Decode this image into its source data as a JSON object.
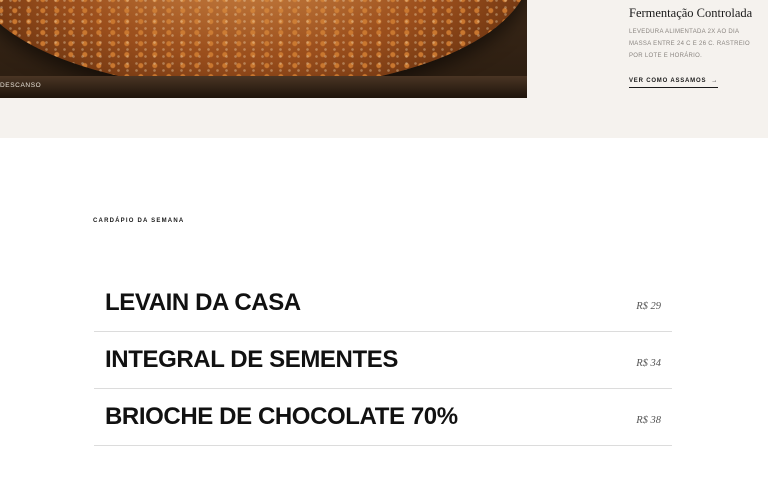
{
  "hero": {
    "caption": "DESCANSO"
  },
  "feature_card": {
    "title": "Fermentação Controlada",
    "description": "LEVEDURA ALIMENTADA 2X AO DIA MASSA ENTRE 24 C E 26 C. RASTREIO POR LOTE E HORÁRIO.",
    "link_label": "VER COMO ASSAMOS",
    "link_arrow": "→"
  },
  "menu": {
    "section_label": "CARDÁPIO DA SEMANA",
    "items": [
      {
        "name": "LEVAIN DA CASA",
        "price": "R$ 29"
      },
      {
        "name": "INTEGRAL DE SEMENTES",
        "price": "R$ 34"
      },
      {
        "name": "BRIOCHE DE CHOCOLATE 70%",
        "price": "R$ 38"
      }
    ]
  }
}
